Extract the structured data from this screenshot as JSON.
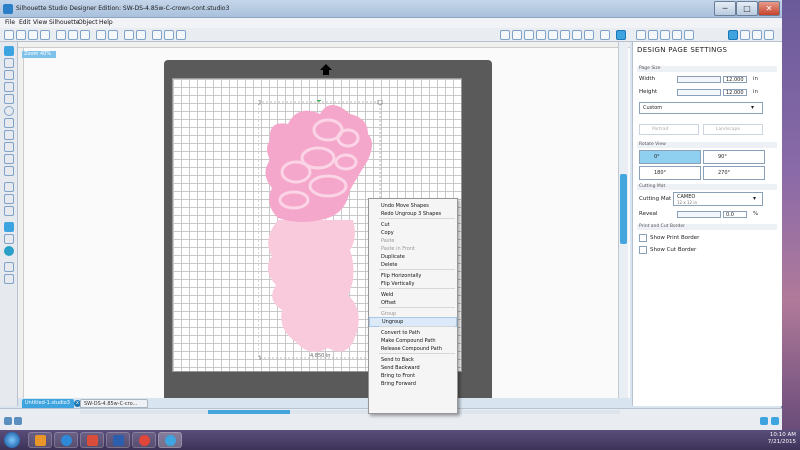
{
  "window": {
    "title": "Silhouette Studio Designer Edition: SW-DS-4.85w-C-crown-cont.studio3",
    "controls": {
      "minimize": "─",
      "maximize": "□",
      "close": "✕"
    }
  },
  "menu": [
    "File",
    "Edit",
    "View",
    "Silhouette",
    "Object",
    "Help"
  ],
  "canvas": {
    "zoom_tag": "Zoom 40%",
    "width_readout": "4.850 in"
  },
  "doc_tabs": [
    {
      "label": "Untitled-1.studio3",
      "badge": "x"
    },
    {
      "label": "SW-DS-4.85w-C-cro..."
    }
  ],
  "panel": {
    "title": "DESIGN PAGE SETTINGS",
    "page_size": {
      "heading": "Page Size",
      "width_label": "Width",
      "width_value": "12.000",
      "height_label": "Height",
      "height_value": "12.000",
      "unit": "in",
      "preset": "Custom",
      "portrait": "Portrait",
      "landscape": "Landscape"
    },
    "rotate_view": {
      "heading": "Rotate View",
      "options": [
        "0°",
        "90°",
        "180°",
        "270°"
      ],
      "selected": "0°"
    },
    "cutting_mat": {
      "heading": "Cutting Mat",
      "label": "Cutting Mat",
      "value": "CAMEO",
      "sub": "12 x 12 in",
      "reveal_label": "Reveal",
      "reveal_value": "0.0",
      "reveal_unit": "%"
    },
    "print_cut": {
      "heading": "Print and Cut Border",
      "show_print_border": "Show Print Border",
      "show_cut_border": "Show Cut Border"
    }
  },
  "context_menu": {
    "items": [
      {
        "label": "Undo Move Shapes",
        "state": "normal"
      },
      {
        "label": "Redo Ungroup 3 Shapes",
        "state": "normal"
      },
      {
        "sep": true
      },
      {
        "label": "Cut",
        "state": "normal"
      },
      {
        "label": "Copy",
        "state": "normal"
      },
      {
        "label": "Paste",
        "state": "disabled"
      },
      {
        "label": "Paste in Front",
        "state": "disabled"
      },
      {
        "label": "Duplicate",
        "state": "normal"
      },
      {
        "label": "Delete",
        "state": "normal"
      },
      {
        "sep": true
      },
      {
        "label": "Flip Horizontally",
        "state": "normal"
      },
      {
        "label": "Flip Vertically",
        "state": "normal"
      },
      {
        "sep": true
      },
      {
        "label": "Weld",
        "state": "normal"
      },
      {
        "label": "Offset",
        "state": "normal"
      },
      {
        "sep": true
      },
      {
        "label": "Group",
        "state": "disabled"
      },
      {
        "label": "Ungroup",
        "state": "highlighted"
      },
      {
        "sep": true
      },
      {
        "label": "Convert to Path",
        "state": "normal"
      },
      {
        "label": "Make Compound Path",
        "state": "normal"
      },
      {
        "label": "Release Compound Path",
        "state": "normal"
      },
      {
        "sep": true
      },
      {
        "label": "Send to Back",
        "state": "normal"
      },
      {
        "label": "Send Backward",
        "state": "normal"
      },
      {
        "label": "Bring to Front",
        "state": "normal"
      },
      {
        "label": "Bring Forward",
        "state": "normal"
      }
    ]
  },
  "taskbar": {
    "time": "10:10 AM",
    "date": "7/21/2015"
  },
  "colors": {
    "accent": "#3ea4e0",
    "crown_dark": "#f5a7cb",
    "crown_light": "#f8c6dc"
  }
}
